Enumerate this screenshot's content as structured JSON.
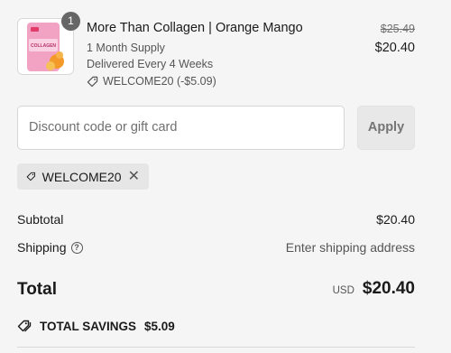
{
  "product": {
    "quantity": "1",
    "name": "More Than Collagen | Orange Mango",
    "supply": "1 Month Supply",
    "delivery": "Delivered Every 4 Weeks",
    "discount_applied": "WELCOME20 (-$5.09)",
    "original_price": "$25.49",
    "price": "$20.40",
    "image_label": "COLLAGEN"
  },
  "discount": {
    "placeholder": "Discount code or gift card",
    "apply_label": "Apply",
    "applied_code": "WELCOME20",
    "remove_glyph": "✕"
  },
  "summary": {
    "subtotal_label": "Subtotal",
    "subtotal_value": "$20.40",
    "shipping_label": "Shipping",
    "shipping_help": "?",
    "shipping_value": "Enter shipping address",
    "total_label": "Total",
    "currency": "USD",
    "total_value": "$20.40",
    "savings_label": "TOTAL SAVINGS",
    "savings_value": "$5.09"
  },
  "colors": {
    "background": "#f5f5f5",
    "badge": "#666666",
    "product_pink": "#f2a3c4",
    "product_orange": "#f39a2a"
  }
}
